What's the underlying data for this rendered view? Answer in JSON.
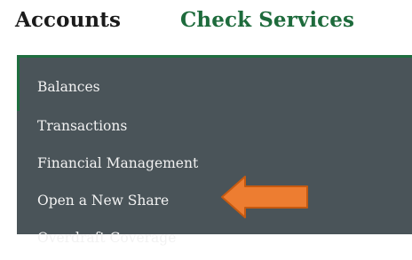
{
  "nav": {
    "accounts_label": "Accounts",
    "check_services_label": "Check Services"
  },
  "menu": {
    "items": [
      {
        "label": "Balances"
      },
      {
        "label": "Transactions"
      },
      {
        "label": "Financial Management"
      },
      {
        "label": "Open a New Share"
      },
      {
        "label": "Overdraft Coverage"
      }
    ]
  },
  "annotation": {
    "arrow_icon": "left-arrow-icon",
    "arrow_color": "#ed7d31"
  },
  "colors": {
    "brand_green": "#1f6e3f",
    "dropdown_bg": "#4a5459",
    "menu_text": "#f2f2f2"
  }
}
